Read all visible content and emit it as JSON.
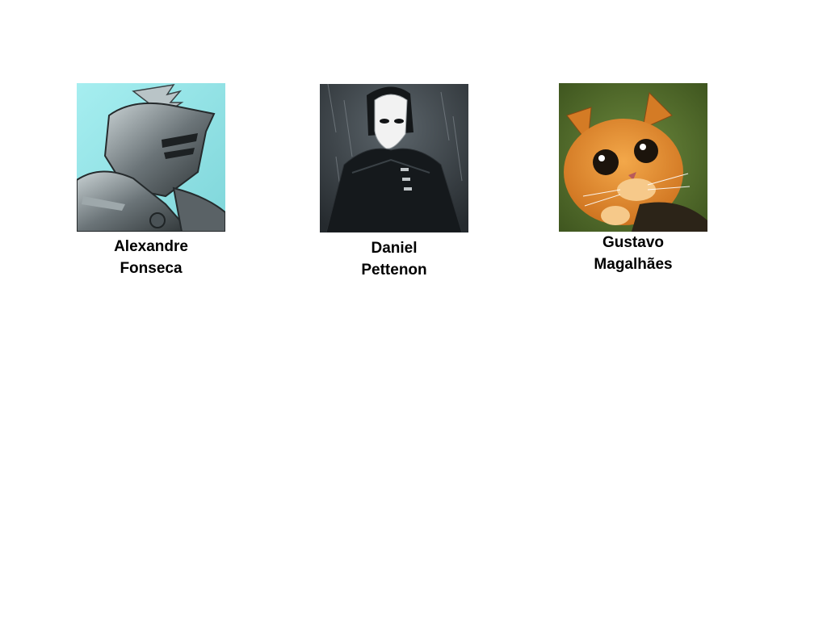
{
  "members": [
    {
      "first_name": "Alexandre",
      "last_name": "Fonseca",
      "avatar_icon": "armored-knight-avatar",
      "colors": {
        "sky": "#8fe3e6",
        "armor": "#6b7478",
        "highlight": "#c9d2d4",
        "shadow": "#2f3537"
      }
    },
    {
      "first_name": "Daniel",
      "last_name": "Pettenon",
      "avatar_icon": "masked-figure-avatar",
      "colors": {
        "bg": "#3c4247",
        "cloak": "#15191c",
        "mask": "#f2f2f2",
        "rain": "#8d959b"
      }
    },
    {
      "first_name": "Gustavo",
      "last_name": "Magalhães",
      "avatar_icon": "orange-cat-avatar",
      "colors": {
        "bg": "#4f6a2b",
        "fur": "#e08a2c",
        "fur_light": "#f6c98a",
        "eye": "#1c140c"
      }
    }
  ]
}
